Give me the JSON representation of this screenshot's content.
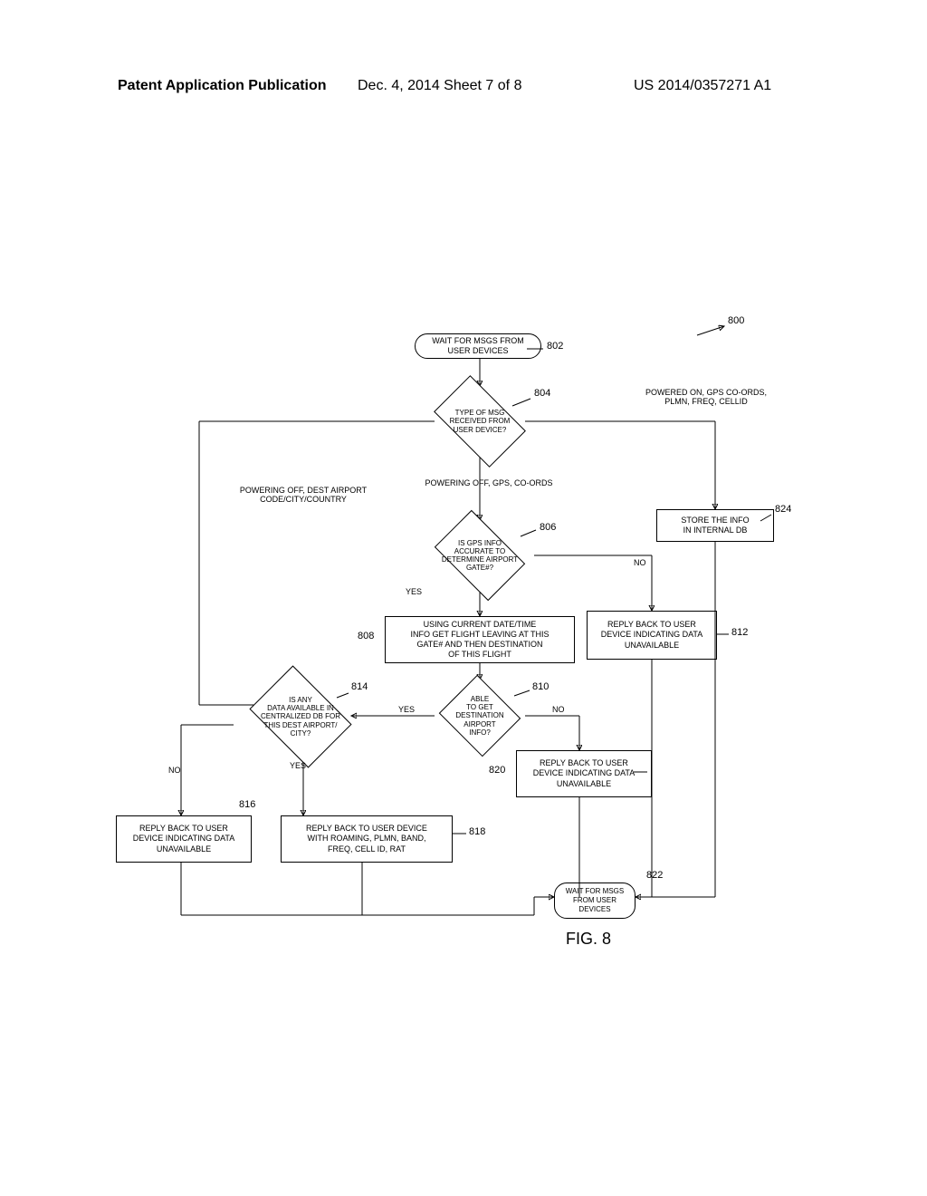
{
  "header": {
    "left": "Patent Application Publication",
    "center": "Dec. 4, 2014   Sheet 7 of 8",
    "right": "US 2014/0357271 A1"
  },
  "figure": {
    "caption": "FIG. 8",
    "overall_ref": "800"
  },
  "nodes": {
    "n802": "WAIT FOR MSGS FROM\nUSER DEVICES",
    "n804": "TYPE OF MSG\nRECEIVED FROM\nUSER DEVICE?",
    "n806": "IS GPS INFO\nACCURATE TO\nDETERMINE AIRPORT\nGATE#?",
    "n808": "USING CURRENT DATE/TIME\nINFO GET FLIGHT LEAVING AT THIS\nGATE# AND THEN DESTINATION\nOF THIS FLIGHT",
    "n810": "ABLE\nTO GET\nDESTINATION\nAIRPORT\nINFO?",
    "n812": "REPLY BACK TO USER\nDEVICE INDICATING DATA\nUNAVAILABLE",
    "n814": "IS ANY\nDATA AVAILABLE IN\nCENTRALIZED DB FOR\nTHIS DEST AIRPORT/\nCITY?",
    "n816": "REPLY BACK TO USER\nDEVICE INDICATING DATA\nUNAVAILABLE",
    "n818": "REPLY BACK TO USER DEVICE\nWITH ROAMING, PLMN, BAND,\nFREQ, CELL ID, RAT",
    "n820": "REPLY BACK TO USER\nDEVICE INDICATING DATA\nUNAVAILABLE",
    "n822": "WAIT FOR MSGS\nFROM USER\nDEVICES",
    "n824": "STORE THE INFO\nIN INTERNAL DB"
  },
  "labels": {
    "branch_left": "POWERING OFF, DEST AIRPORT\nCODE/CITY/COUNTRY",
    "branch_center": "POWERING OFF, GPS, CO-ORDS",
    "branch_right": "POWERED ON, GPS CO-ORDS,\nPLMN, FREQ, CELLID",
    "yes": "YES",
    "no": "NO"
  },
  "refs": {
    "r800": "800",
    "r802": "802",
    "r804": "804",
    "r806": "806",
    "r808": "808",
    "r810": "810",
    "r812": "812",
    "r814": "814",
    "r816": "816",
    "r818": "818",
    "r820": "820",
    "r822": "822",
    "r824": "824"
  }
}
